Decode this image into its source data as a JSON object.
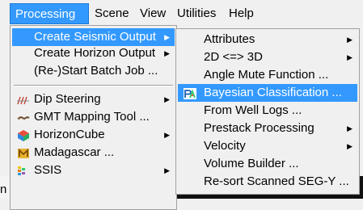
{
  "menubar": {
    "items": [
      "Processing",
      "Scene",
      "View",
      "Utilities",
      "Help"
    ]
  },
  "processing_menu": {
    "items": [
      {
        "label": "Create Seismic Output",
        "submenu": true
      },
      {
        "label": "Create Horizon Output",
        "submenu": true
      },
      {
        "label": "(Re-)Start Batch Job ...",
        "submenu": false
      },
      {
        "label": "Dip Steering",
        "submenu": true,
        "icon": "dip-steering-icon"
      },
      {
        "label": "GMT Mapping Tool ...",
        "submenu": false,
        "icon": "gmt-icon"
      },
      {
        "label": "HorizonCube",
        "submenu": true,
        "icon": "horizoncube-icon"
      },
      {
        "label": "Madagascar ...",
        "submenu": false,
        "icon": "madagascar-icon"
      },
      {
        "label": "SSIS",
        "submenu": true,
        "icon": "ssis-icon"
      }
    ]
  },
  "seismic_output_submenu": {
    "items": [
      {
        "label": "Attributes",
        "submenu": true
      },
      {
        "label": "2D <=> 3D",
        "submenu": true
      },
      {
        "label": "Angle Mute Function ...",
        "submenu": false
      },
      {
        "label": "Bayesian Classification ...",
        "submenu": false,
        "icon": "bayesian-icon"
      },
      {
        "label": "From Well Logs ...",
        "submenu": false
      },
      {
        "label": "Prestack Processing",
        "submenu": true
      },
      {
        "label": "Velocity",
        "submenu": true
      },
      {
        "label": "Volume Builder ...",
        "submenu": false
      },
      {
        "label": "Re-sort Scanned SEG-Y ...",
        "submenu": false
      }
    ]
  },
  "background": {
    "panel_text": "n Line"
  },
  "colors": {
    "highlight": "#3399ff",
    "menu_bg": "#f0f0f0"
  }
}
